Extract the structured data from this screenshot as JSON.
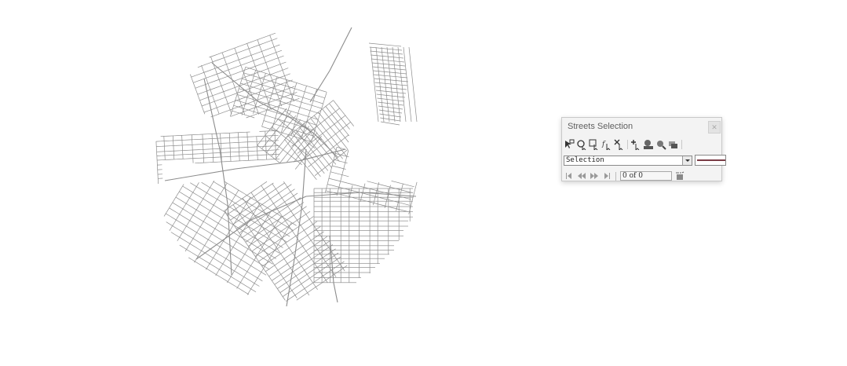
{
  "dialog": {
    "title": "Streets Selection",
    "close_icon": "close-icon",
    "toolbar_icons": [
      "select-features-icon",
      "select-by-location-icon",
      "select-by-attributes-icon",
      "add-to-selection-icon",
      "remove-from-selection-icon",
      "add-feature-icon",
      "zoom-to-selection-icon",
      "zoom-icon",
      "layers-icon"
    ],
    "selection_value": "Selection",
    "record_value": "0 of 0",
    "nav_icons": [
      "first-record-icon",
      "previous-record-icon",
      "next-record-icon",
      "last-record-icon"
    ],
    "flash_icon": "flash-feature-icon",
    "swatch_color": "#7a3c46"
  },
  "map": {
    "background": "#ffffff",
    "street_color": "#8c8c8c"
  }
}
